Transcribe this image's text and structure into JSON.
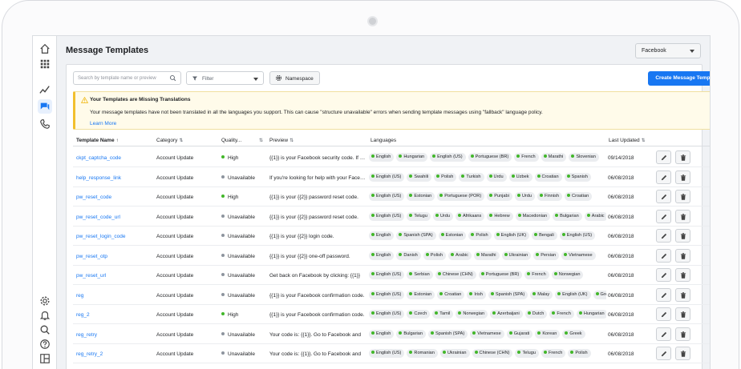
{
  "page": {
    "title": "Message Templates",
    "platform_select": "Facebook"
  },
  "toolbar": {
    "search_placeholder": "Search by template name or preview",
    "filter_label": "Filter",
    "namespace_label": "Namespace",
    "create_label": "Create Message Template"
  },
  "banner": {
    "title": "Your Templates are Missing Translations",
    "text": "Your message templates have not been translated in all the languages you support. This can cause \"structure unavailable\" errors when sending template messages using \"fallback\" language policy.",
    "link": "Learn More"
  },
  "table": {
    "headers": {
      "name": "Template Name",
      "name_sort": "↑",
      "category": "Category",
      "category_sort": "⇅",
      "quality": "Quality...",
      "quality_sort": "⇅",
      "preview": "Preview",
      "preview_sort": "⇅",
      "languages": "Languages",
      "updated": "Last Updated",
      "updated_sort": "⇅"
    },
    "rows": [
      {
        "name": "ckpt_captcha_code",
        "category": "Account Update",
        "quality": "High",
        "preview": "{{1}} is your Facebook security code. If y...",
        "languages": [
          "English",
          "Hungarian",
          "English (US)",
          "Portuguese (BR)",
          "French",
          "Marathi",
          "Slovenian"
        ],
        "updated": "09/14/2018"
      },
      {
        "name": "help_response_link",
        "category": "Account Update",
        "quality": "Unavailable",
        "preview": "If you're looking for help with your Facebook",
        "languages": [
          "English (US)",
          "Swahili",
          "Polish",
          "Turkish",
          "Urdu",
          "Uzbek",
          "Croatian",
          "Spanish"
        ],
        "updated": "06/08/2018"
      },
      {
        "name": "pw_reset_code",
        "category": "Account Update",
        "quality": "High",
        "preview": "{{1}} is your {{2}} password reset code.",
        "languages": [
          "English (US)",
          "Estonian",
          "Portuguese (POR)",
          "Punjabi",
          "Urdu",
          "Finnish",
          "Croatian"
        ],
        "updated": "06/08/2018"
      },
      {
        "name": "pw_reset_code_url",
        "category": "Account Update",
        "quality": "Unavailable",
        "preview": "{{1}} is your {{2}} password reset code.",
        "languages": [
          "English (US)",
          "Telugu",
          "Urdu",
          "Afrikaans",
          "Hebrew",
          "Macedonian",
          "Bulgarian",
          "Arabic"
        ],
        "updated": "06/08/2018"
      },
      {
        "name": "pw_reset_login_code",
        "category": "Account Update",
        "quality": "Unavailable",
        "preview": "{{1}} is your {{2}} login code.",
        "languages": [
          "English",
          "Spanish (SPA)",
          "Estonian",
          "Polish",
          "English (UK)",
          "Bengali",
          "English (US)"
        ],
        "updated": "06/08/2018"
      },
      {
        "name": "pw_reset_otp",
        "category": "Account Update",
        "quality": "Unavailable",
        "preview": "{{1}} is your {{2}} one-off password.",
        "languages": [
          "English",
          "Danish",
          "Polish",
          "Arabic",
          "Marathi",
          "Ukrainian",
          "Persian",
          "Vietnamese"
        ],
        "updated": "06/08/2018"
      },
      {
        "name": "pw_reset_url",
        "category": "Account Update",
        "quality": "Unavailable",
        "preview": "Get back on Facebook by clicking: {{1}}",
        "languages": [
          "English (US)",
          "Serbian",
          "Chinese (CHN)",
          "Portuguese (BR)",
          "French",
          "Norwegian"
        ],
        "updated": "06/08/2018"
      },
      {
        "name": "reg",
        "category": "Account Update",
        "quality": "Unavailable",
        "preview": "{{1}} is your Facebook confirmation code.",
        "languages": [
          "English (US)",
          "Estonian",
          "Croatian",
          "Irish",
          "Spanish (SPA)",
          "Malay",
          "English (UK)",
          "Greek"
        ],
        "updated": "06/08/2018"
      },
      {
        "name": "reg_2",
        "category": "Account Update",
        "quality": "High",
        "preview": "{{1}} is your Facebook confirmation code.",
        "languages": [
          "English (US)",
          "Czech",
          "Tamil",
          "Norwegian",
          "Azerbaijani",
          "Dutch",
          "French",
          "Hungarian"
        ],
        "updated": "06/08/2018"
      },
      {
        "name": "reg_retry",
        "category": "Account Update",
        "quality": "Unavailable",
        "preview": "Your code is: {{1}}. Go to Facebook and",
        "languages": [
          "English",
          "Bulgarian",
          "Spanish (SPA)",
          "Vietnamese",
          "Gujarati",
          "Korean",
          "Greek"
        ],
        "updated": "06/08/2018"
      },
      {
        "name": "reg_retry_2",
        "category": "Account Update",
        "quality": "Unavailable",
        "preview": "Your code is: {{1}}. Go to Facebook and",
        "languages": [
          "English (US)",
          "Romanian",
          "Ukrainian",
          "Chinese (CHN)",
          "Telugu",
          "French",
          "Polish"
        ],
        "updated": "06/08/2018"
      }
    ]
  },
  "colors": {
    "accent": "#1877f2",
    "quality_high": "#42b72a",
    "quality_unavailable": "#8d949e",
    "language_dot": "#42b72a",
    "warning": "#f2c02e"
  },
  "icons": {
    "rail_top": [
      "home-icon",
      "apps-grid-icon",
      "insights-icon",
      "chat-icon",
      "phone-icon"
    ],
    "rail_bottom": [
      "settings-icon",
      "bell-icon",
      "search-icon",
      "help-icon",
      "panel-icon"
    ],
    "row_actions": [
      "pencil-icon",
      "trash-icon"
    ]
  }
}
